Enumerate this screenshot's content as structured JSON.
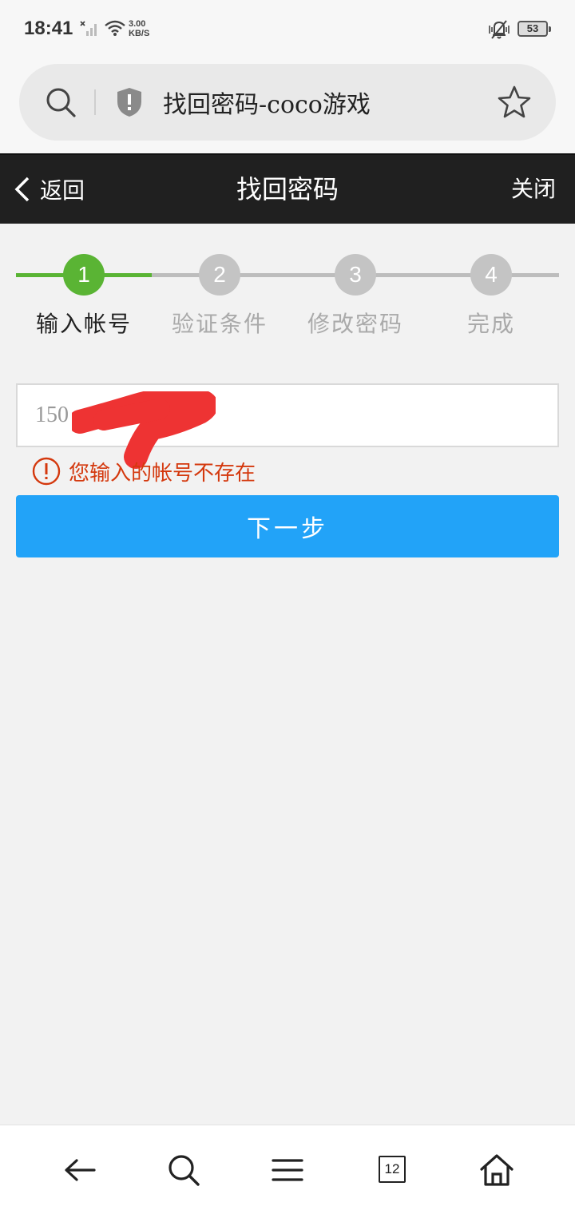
{
  "status_bar": {
    "time": "18:41",
    "net_speed_value": "3.00",
    "net_speed_unit": "KB/S",
    "battery": "53"
  },
  "browser": {
    "page_title": "找回密码-coco游戏"
  },
  "header": {
    "back_label": "返回",
    "title": "找回密码",
    "close_label": "关闭"
  },
  "steps": [
    {
      "number": "1",
      "label": "输入帐号",
      "active": true
    },
    {
      "number": "2",
      "label": "验证条件",
      "active": false
    },
    {
      "number": "3",
      "label": "修改密码",
      "active": false
    },
    {
      "number": "4",
      "label": "完成",
      "active": false
    }
  ],
  "form": {
    "account_value": "150",
    "error_message": "您输入的帐号不存在",
    "next_label": "下一步"
  },
  "bottom_nav": {
    "tab_count": "12"
  },
  "colors": {
    "accent_green": "#5ab434",
    "button_blue": "#22a3f8",
    "error_red": "#d4380d",
    "header_dark": "#202020"
  }
}
